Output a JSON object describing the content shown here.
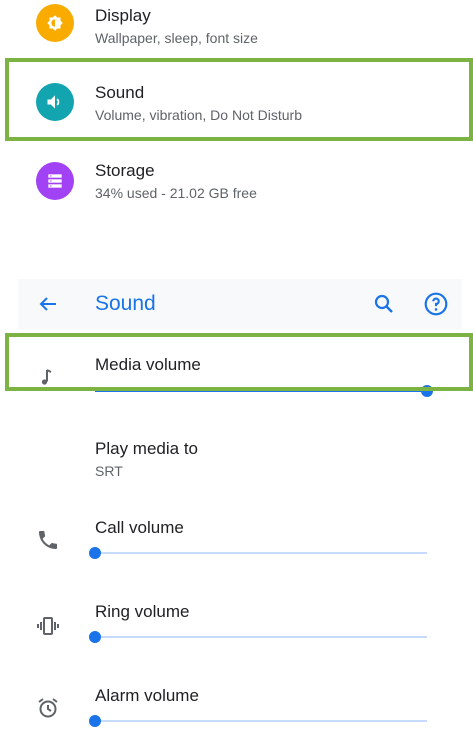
{
  "settings": {
    "items": [
      {
        "title": "Display",
        "subtitle": "Wallpaper, sleep, font size",
        "icon": "display-brightness-icon",
        "color": "#f9ab00"
      },
      {
        "title": "Sound",
        "subtitle": "Volume, vibration, Do Not Disturb",
        "icon": "volume-icon",
        "color": "#12a4af"
      },
      {
        "title": "Storage",
        "subtitle": "34% used - 21.02 GB free",
        "icon": "storage-icon",
        "color": "#a142f4"
      }
    ]
  },
  "sound": {
    "title": "Sound",
    "back_icon": "arrow-back-icon",
    "search_icon": "search-icon",
    "help_icon": "help-icon",
    "media_volume": {
      "label": "Media volume",
      "level": 1.0,
      "icon": "music-note-icon"
    },
    "play_media_to": {
      "label": "Play media to",
      "value": "SRT"
    },
    "call_volume": {
      "label": "Call volume",
      "level": 0.0,
      "icon": "phone-icon"
    },
    "ring_volume": {
      "label": "Ring volume",
      "level": 0.0,
      "icon": "vibrate-icon"
    },
    "alarm_volume": {
      "label": "Alarm volume",
      "level": 0.0,
      "icon": "alarm-icon"
    }
  },
  "colors": {
    "accent": "#1a73e8",
    "highlight": "#7cb342",
    "track": "#c6dafc"
  }
}
